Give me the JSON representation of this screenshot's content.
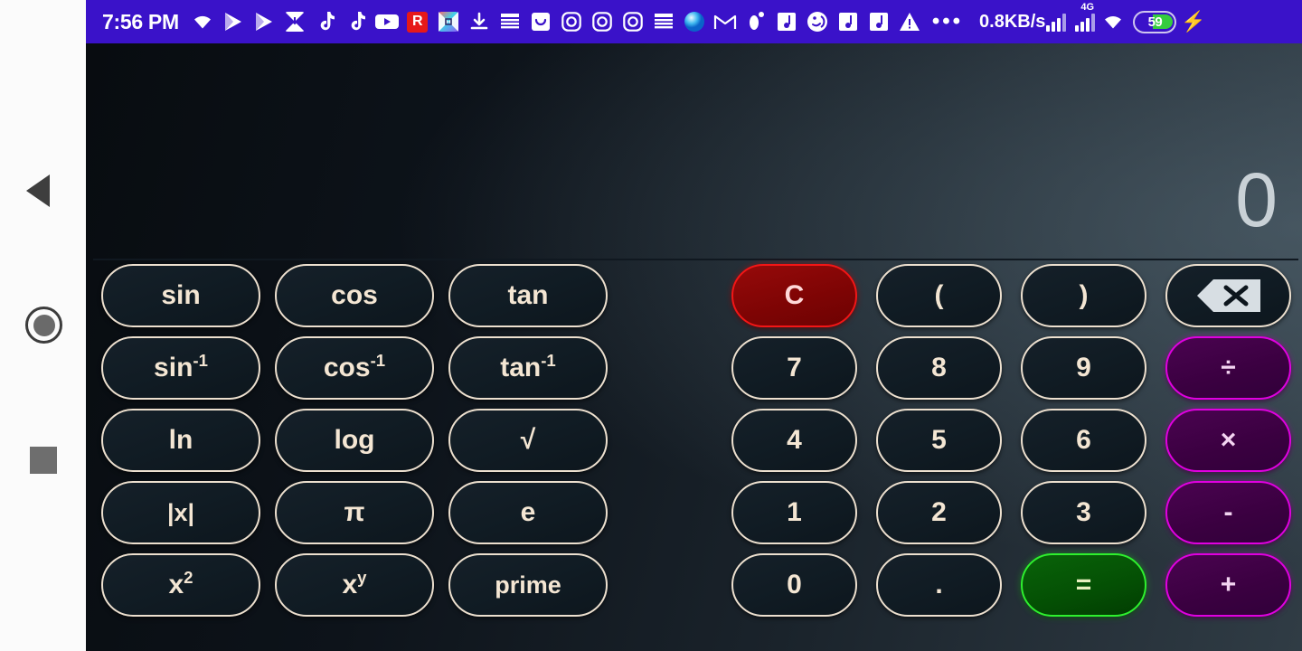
{
  "statusbar": {
    "clock": "7:56 PM",
    "network_speed": "0.8KB/s",
    "sim_generation": "4G",
    "battery_level": "59",
    "overflow_dots": "•••",
    "notification_icons": [
      {
        "name": "wifi-alert-icon",
        "glyph": ""
      },
      {
        "name": "play-store-icon-1",
        "glyph": ""
      },
      {
        "name": "play-store-icon-2",
        "glyph": ""
      },
      {
        "name": "photos-download-icon",
        "glyph": ""
      },
      {
        "name": "tiktok-icon-1",
        "glyph": "♪"
      },
      {
        "name": "tiktok-icon-2",
        "glyph": "♪"
      },
      {
        "name": "youtube-icon",
        "glyph": "▶"
      },
      {
        "name": "r-app-icon",
        "glyph": "R"
      },
      {
        "name": "colorful-app-icon",
        "glyph": ""
      },
      {
        "name": "download-icon",
        "glyph": "↓"
      },
      {
        "name": "english-learning-icon-1",
        "glyph": ""
      },
      {
        "name": "smile-bag-icon",
        "glyph": "∪"
      },
      {
        "name": "instagram-icon-1",
        "glyph": "◎"
      },
      {
        "name": "instagram-icon-2",
        "glyph": "◎"
      },
      {
        "name": "instagram-icon-3",
        "glyph": "◎"
      },
      {
        "name": "english-learning-icon-2",
        "glyph": ""
      },
      {
        "name": "browser-icon",
        "glyph": "●"
      },
      {
        "name": "gmail-icon",
        "glyph": "M"
      },
      {
        "name": "footprint-icon",
        "glyph": ""
      },
      {
        "name": "music-note-icon-1",
        "glyph": "♪"
      },
      {
        "name": "audio-wave-icon",
        "glyph": "☺"
      },
      {
        "name": "music-note-icon-2",
        "glyph": "♪"
      },
      {
        "name": "music-note-icon-3",
        "glyph": "♪"
      },
      {
        "name": "warning-triangle-icon",
        "glyph": "⚠"
      }
    ]
  },
  "navbar": {
    "back_label": "Back",
    "home_label": "Home",
    "recents_label": "Recents"
  },
  "display": {
    "value": "0"
  },
  "keypad": {
    "scientific": [
      {
        "id": "sin",
        "label": "sin",
        "sup": "",
        "kind": "normal"
      },
      {
        "id": "cos",
        "label": "cos",
        "sup": "",
        "kind": "normal"
      },
      {
        "id": "tan",
        "label": "tan",
        "sup": "",
        "kind": "normal"
      },
      {
        "id": "asin",
        "label": "sin",
        "sup": "-1",
        "kind": "normal"
      },
      {
        "id": "acos",
        "label": "cos",
        "sup": "-1",
        "kind": "normal"
      },
      {
        "id": "atan",
        "label": "tan",
        "sup": "-1",
        "kind": "normal"
      },
      {
        "id": "ln",
        "label": "ln",
        "sup": "",
        "kind": "normal"
      },
      {
        "id": "log",
        "label": "log",
        "sup": "",
        "kind": "normal"
      },
      {
        "id": "sqrt",
        "label": "√",
        "sup": "",
        "kind": "normal"
      },
      {
        "id": "abs",
        "label": "|x|",
        "sup": "",
        "kind": "normal"
      },
      {
        "id": "pi",
        "label": "π",
        "sup": "",
        "kind": "normal"
      },
      {
        "id": "e",
        "label": "e",
        "sup": "",
        "kind": "normal"
      },
      {
        "id": "square",
        "label": "x",
        "sup": "2",
        "kind": "normal"
      },
      {
        "id": "power",
        "label": "x",
        "sup": "y",
        "kind": "normal"
      },
      {
        "id": "prime",
        "label": "prime",
        "sup": "",
        "kind": "normal"
      }
    ],
    "numeric": [
      {
        "id": "clear",
        "label": "C",
        "kind": "clear"
      },
      {
        "id": "paren-open",
        "label": "(",
        "kind": "normal"
      },
      {
        "id": "paren-close",
        "label": ")",
        "kind": "normal"
      },
      {
        "id": "backspace",
        "label": "",
        "kind": "backspace"
      },
      {
        "id": "seven",
        "label": "7",
        "kind": "normal"
      },
      {
        "id": "eight",
        "label": "8",
        "kind": "normal"
      },
      {
        "id": "nine",
        "label": "9",
        "kind": "normal"
      },
      {
        "id": "divide",
        "label": "÷",
        "kind": "op"
      },
      {
        "id": "four",
        "label": "4",
        "kind": "normal"
      },
      {
        "id": "five",
        "label": "5",
        "kind": "normal"
      },
      {
        "id": "six",
        "label": "6",
        "kind": "normal"
      },
      {
        "id": "multiply",
        "label": "×",
        "kind": "op"
      },
      {
        "id": "one",
        "label": "1",
        "kind": "normal"
      },
      {
        "id": "two",
        "label": "2",
        "kind": "normal"
      },
      {
        "id": "three",
        "label": "3",
        "kind": "normal"
      },
      {
        "id": "minus",
        "label": "-",
        "kind": "op"
      },
      {
        "id": "zero",
        "label": "0",
        "kind": "normal"
      },
      {
        "id": "decimal",
        "label": ".",
        "kind": "normal"
      },
      {
        "id": "equals",
        "label": "=",
        "kind": "equals"
      },
      {
        "id": "plus",
        "label": "+",
        "kind": "op"
      }
    ]
  },
  "colors": {
    "statusbar_bg": "#3a12c9",
    "key_border": "#ede0cf",
    "key_text": "#f4e6d3",
    "clear_border": "#f21616",
    "operator_border": "#e000e0",
    "equals_border": "#2ef02e",
    "display_text": "#c9d1d6",
    "battery_fill": "#35cc3e"
  }
}
